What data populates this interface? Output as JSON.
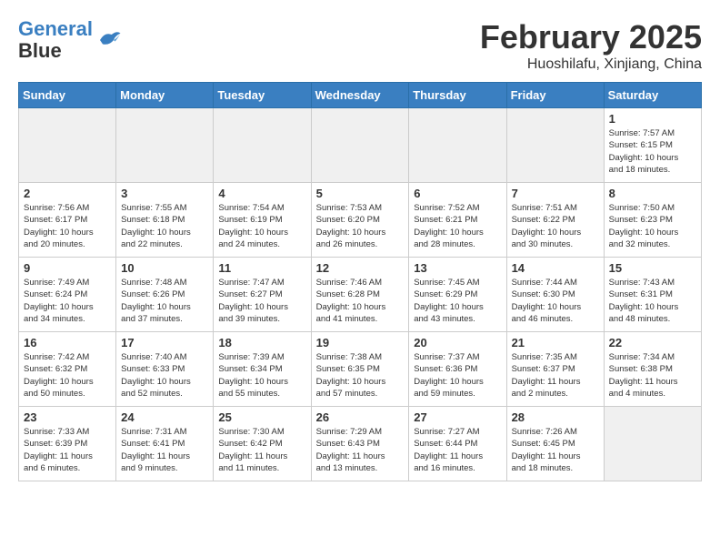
{
  "header": {
    "logo_line1": "General",
    "logo_line2": "Blue",
    "month": "February 2025",
    "location": "Huoshilafu, Xinjiang, China"
  },
  "days_of_week": [
    "Sunday",
    "Monday",
    "Tuesday",
    "Wednesday",
    "Thursday",
    "Friday",
    "Saturday"
  ],
  "weeks": [
    [
      {
        "day": "",
        "info": ""
      },
      {
        "day": "",
        "info": ""
      },
      {
        "day": "",
        "info": ""
      },
      {
        "day": "",
        "info": ""
      },
      {
        "day": "",
        "info": ""
      },
      {
        "day": "",
        "info": ""
      },
      {
        "day": "1",
        "info": "Sunrise: 7:57 AM\nSunset: 6:15 PM\nDaylight: 10 hours\nand 18 minutes."
      }
    ],
    [
      {
        "day": "2",
        "info": "Sunrise: 7:56 AM\nSunset: 6:17 PM\nDaylight: 10 hours\nand 20 minutes."
      },
      {
        "day": "3",
        "info": "Sunrise: 7:55 AM\nSunset: 6:18 PM\nDaylight: 10 hours\nand 22 minutes."
      },
      {
        "day": "4",
        "info": "Sunrise: 7:54 AM\nSunset: 6:19 PM\nDaylight: 10 hours\nand 24 minutes."
      },
      {
        "day": "5",
        "info": "Sunrise: 7:53 AM\nSunset: 6:20 PM\nDaylight: 10 hours\nand 26 minutes."
      },
      {
        "day": "6",
        "info": "Sunrise: 7:52 AM\nSunset: 6:21 PM\nDaylight: 10 hours\nand 28 minutes."
      },
      {
        "day": "7",
        "info": "Sunrise: 7:51 AM\nSunset: 6:22 PM\nDaylight: 10 hours\nand 30 minutes."
      },
      {
        "day": "8",
        "info": "Sunrise: 7:50 AM\nSunset: 6:23 PM\nDaylight: 10 hours\nand 32 minutes."
      }
    ],
    [
      {
        "day": "9",
        "info": "Sunrise: 7:49 AM\nSunset: 6:24 PM\nDaylight: 10 hours\nand 34 minutes."
      },
      {
        "day": "10",
        "info": "Sunrise: 7:48 AM\nSunset: 6:26 PM\nDaylight: 10 hours\nand 37 minutes."
      },
      {
        "day": "11",
        "info": "Sunrise: 7:47 AM\nSunset: 6:27 PM\nDaylight: 10 hours\nand 39 minutes."
      },
      {
        "day": "12",
        "info": "Sunrise: 7:46 AM\nSunset: 6:28 PM\nDaylight: 10 hours\nand 41 minutes."
      },
      {
        "day": "13",
        "info": "Sunrise: 7:45 AM\nSunset: 6:29 PM\nDaylight: 10 hours\nand 43 minutes."
      },
      {
        "day": "14",
        "info": "Sunrise: 7:44 AM\nSunset: 6:30 PM\nDaylight: 10 hours\nand 46 minutes."
      },
      {
        "day": "15",
        "info": "Sunrise: 7:43 AM\nSunset: 6:31 PM\nDaylight: 10 hours\nand 48 minutes."
      }
    ],
    [
      {
        "day": "16",
        "info": "Sunrise: 7:42 AM\nSunset: 6:32 PM\nDaylight: 10 hours\nand 50 minutes."
      },
      {
        "day": "17",
        "info": "Sunrise: 7:40 AM\nSunset: 6:33 PM\nDaylight: 10 hours\nand 52 minutes."
      },
      {
        "day": "18",
        "info": "Sunrise: 7:39 AM\nSunset: 6:34 PM\nDaylight: 10 hours\nand 55 minutes."
      },
      {
        "day": "19",
        "info": "Sunrise: 7:38 AM\nSunset: 6:35 PM\nDaylight: 10 hours\nand 57 minutes."
      },
      {
        "day": "20",
        "info": "Sunrise: 7:37 AM\nSunset: 6:36 PM\nDaylight: 10 hours\nand 59 minutes."
      },
      {
        "day": "21",
        "info": "Sunrise: 7:35 AM\nSunset: 6:37 PM\nDaylight: 11 hours\nand 2 minutes."
      },
      {
        "day": "22",
        "info": "Sunrise: 7:34 AM\nSunset: 6:38 PM\nDaylight: 11 hours\nand 4 minutes."
      }
    ],
    [
      {
        "day": "23",
        "info": "Sunrise: 7:33 AM\nSunset: 6:39 PM\nDaylight: 11 hours\nand 6 minutes."
      },
      {
        "day": "24",
        "info": "Sunrise: 7:31 AM\nSunset: 6:41 PM\nDaylight: 11 hours\nand 9 minutes."
      },
      {
        "day": "25",
        "info": "Sunrise: 7:30 AM\nSunset: 6:42 PM\nDaylight: 11 hours\nand 11 minutes."
      },
      {
        "day": "26",
        "info": "Sunrise: 7:29 AM\nSunset: 6:43 PM\nDaylight: 11 hours\nand 13 minutes."
      },
      {
        "day": "27",
        "info": "Sunrise: 7:27 AM\nSunset: 6:44 PM\nDaylight: 11 hours\nand 16 minutes."
      },
      {
        "day": "28",
        "info": "Sunrise: 7:26 AM\nSunset: 6:45 PM\nDaylight: 11 hours\nand 18 minutes."
      },
      {
        "day": "",
        "info": ""
      }
    ]
  ]
}
